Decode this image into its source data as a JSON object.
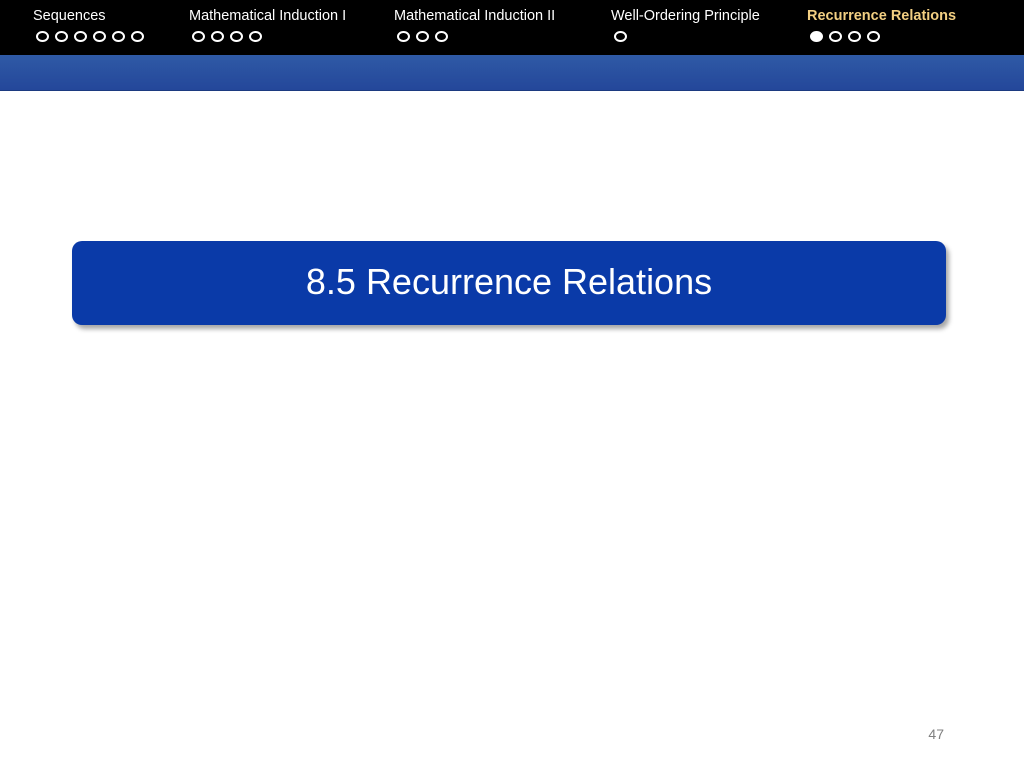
{
  "nav": {
    "sections": [
      {
        "label": "Sequences",
        "dots": 6,
        "filled_index": -1
      },
      {
        "label": "Mathematical Induction I",
        "dots": 4,
        "filled_index": -1
      },
      {
        "label": "Mathematical Induction II",
        "dots": 3,
        "filled_index": -1
      },
      {
        "label": "Well-Ordering Principle",
        "dots": 1,
        "filled_index": -1
      },
      {
        "label": "Recurrence Relations",
        "dots": 4,
        "filled_index": 0,
        "active": true
      }
    ],
    "active_color": "#f2cf82"
  },
  "slide": {
    "title": "8.5 Recurrence Relations",
    "page_number": "47"
  },
  "colors": {
    "navbar": "#000000",
    "subbar": "#2a50a0",
    "title_box": "#0a3aa8"
  }
}
